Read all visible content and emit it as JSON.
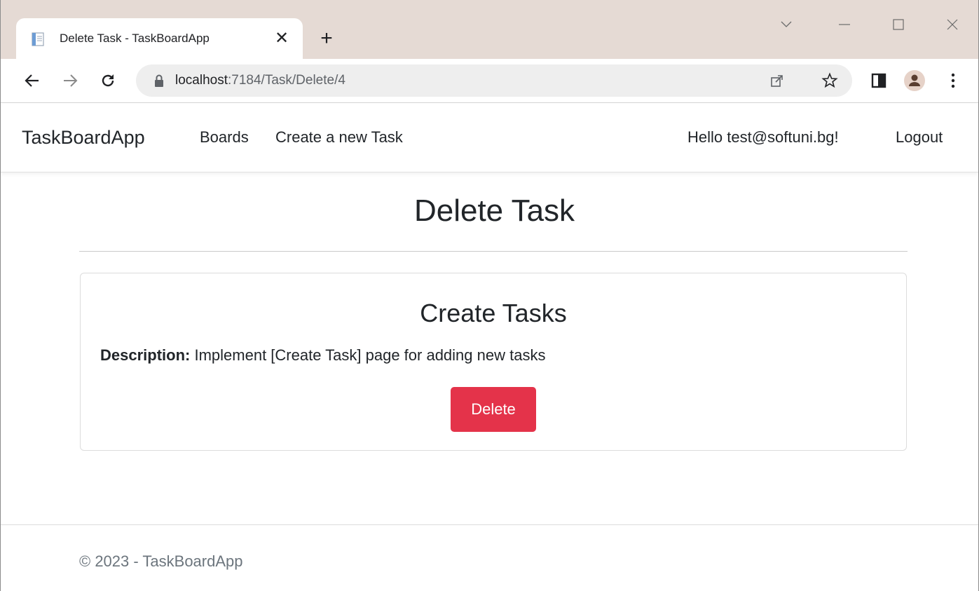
{
  "browser": {
    "tab_title": "Delete Task - TaskBoardApp",
    "tab_close": "✕",
    "new_tab": "+",
    "url_host": "localhost",
    "url_path": ":7184/Task/Delete/4",
    "icons": {
      "back": "back-arrow-icon",
      "forward": "forward-arrow-icon",
      "reload": "reload-icon",
      "lock": "lock-icon",
      "share": "share-icon",
      "bookmark": "star-icon",
      "sidepanel": "side-panel-icon",
      "profile": "profile-avatar-icon",
      "menu": "kebab-menu-icon"
    }
  },
  "navbar": {
    "brand": "TaskBoardApp",
    "links": [
      "Boards",
      "Create a new Task"
    ],
    "greeting": "Hello test@softuni.bg!",
    "logout": "Logout"
  },
  "main": {
    "title": "Delete Task",
    "card": {
      "task_title": "Create Tasks",
      "description_label": "Description:",
      "description_value": "Implement [Create Task] page for adding new tasks",
      "delete_label": "Delete"
    }
  },
  "footer": {
    "text": "© 2023 - TaskBoardApp"
  },
  "colors": {
    "danger": "#e4334a",
    "tabstrip": "#e5dad4",
    "omnibox": "#eeeeee"
  }
}
